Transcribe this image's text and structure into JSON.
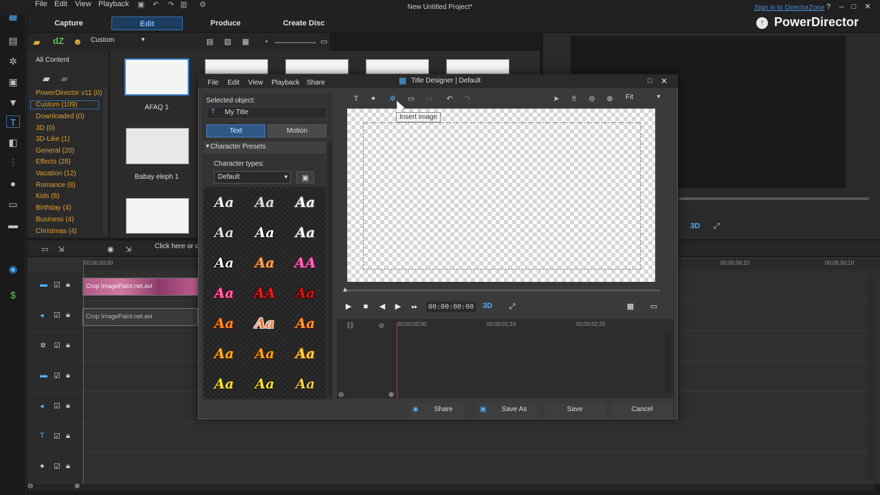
{
  "menu": {
    "file": "File",
    "edit": "Edit",
    "view": "View",
    "playback": "Playback"
  },
  "app_title": "New Untitled Project*",
  "signin": "Sign in to DirectorZone",
  "brand": "PowerDirector",
  "modes": {
    "capture": "Capture",
    "edit": "Edit",
    "produce": "Produce",
    "create_disc": "Create Disc"
  },
  "library": {
    "dropdown": "Custom",
    "all_content": "All Content",
    "categories": [
      {
        "label": "PowerDirector v11  (0)"
      },
      {
        "label": "Custom  (109)"
      },
      {
        "label": "Downloaded  (0)"
      },
      {
        "label": "3D  (0)"
      },
      {
        "label": "3D-Like  (1)"
      },
      {
        "label": "General  (20)"
      },
      {
        "label": "Effects  (28)"
      },
      {
        "label": "Vacation  (12)"
      },
      {
        "label": "Romance  (8)"
      },
      {
        "label": "Kids  (8)"
      },
      {
        "label": "Birthday  (4)"
      },
      {
        "label": "Business  (4)"
      },
      {
        "label": "Christmas  (4)"
      }
    ],
    "thumbs": [
      {
        "label": "AFAQ 1"
      },
      {
        "label": "Babay eleph 1"
      }
    ],
    "click_here": "Click here or dr"
  },
  "timeline": {
    "clip1": "Crop ImagePaint.net.avi",
    "clip2": "Crop ImagePaint.net.avi",
    "ruler": {
      "t1": "00;00;00;00",
      "t2": "00;05;00;10",
      "t3": "00;05;50;10"
    }
  },
  "title_designer": {
    "title": "Title Designer  |  Default",
    "menu": {
      "file": "File",
      "edit": "Edit",
      "view": "View",
      "playback": "Playback",
      "share": "Share"
    },
    "selected_label": "Selected object:",
    "selected_value": "My Title",
    "tab_text": "Text",
    "tab_motion": "Motion",
    "presets_header": "Character Presets",
    "char_types_label": "Character types:",
    "char_types_value": "Default",
    "zoom": "Fit",
    "tooltip": "Insert image",
    "timecode": "00:00:00:00",
    "ruler": {
      "t1": "00;00;00;00",
      "t2": "00;00;01;10",
      "t3": "00;00;02;20"
    },
    "buttons": {
      "share": "Share",
      "save_as": "Save As",
      "save": "Save",
      "cancel": "Cancel"
    },
    "presets": [
      {
        "text": "Aa",
        "color": "#f0f0f0",
        "stroke": "#222"
      },
      {
        "text": "Aa",
        "color": "#dcdcdc",
        "stroke": "#333"
      },
      {
        "text": "Aa",
        "color": "#ffffff",
        "stroke": "#555"
      },
      {
        "text": "Aa",
        "color": "#e0e0e0",
        "stroke": "#111"
      },
      {
        "text": "Aa",
        "color": "#ffffff",
        "stroke": "#111"
      },
      {
        "text": "Aa",
        "color": "#ffffff",
        "stroke": "#444"
      },
      {
        "text": "Aa",
        "color": "#f5f5f5",
        "stroke": "#000"
      },
      {
        "text": "Aa",
        "color": "#f5a860",
        "stroke": "#5a2a00"
      },
      {
        "text": "AA",
        "color": "#ff69b4",
        "stroke": "#661144"
      },
      {
        "text": "Aa",
        "color": "#ff6ea0",
        "stroke": "#660033"
      },
      {
        "text": "AA",
        "color": "#e02020",
        "stroke": "#400"
      },
      {
        "text": "Aa",
        "color": "#d01818",
        "stroke": "#300"
      },
      {
        "text": "Aa",
        "color": "#ff8a20",
        "stroke": "#501800"
      },
      {
        "text": "Aa",
        "color": "#f07a40",
        "stroke": "#ffffff"
      },
      {
        "text": "Aa",
        "color": "#ff9a30",
        "stroke": "#551400"
      },
      {
        "text": "Aa",
        "color": "#ffae20",
        "stroke": "#402200"
      },
      {
        "text": "Aa",
        "color": "#f6a020",
        "stroke": "#3a1a00"
      },
      {
        "text": "Aa",
        "color": "#ffd24a",
        "stroke": "#6a3a00"
      },
      {
        "text": "Aa",
        "color": "#ffe020",
        "stroke": "#222"
      },
      {
        "text": "Aa",
        "color": "#ffe020",
        "stroke": "#111"
      },
      {
        "text": "Aa",
        "color": "#f0d040",
        "stroke": "#111"
      }
    ]
  },
  "colors": {
    "accent": "#3b86d8",
    "category": "#e0a030",
    "playhead": "#d03030"
  }
}
